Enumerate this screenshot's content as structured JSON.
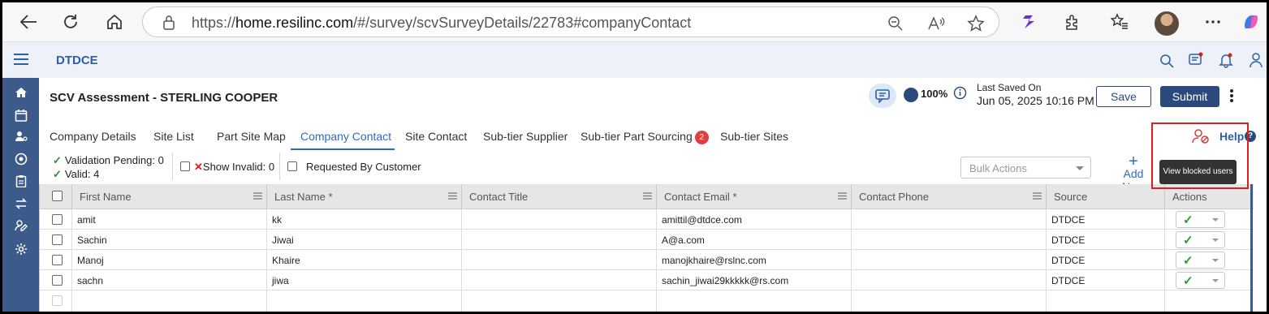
{
  "browser": {
    "url_prefix": "https://",
    "url_host": "home.resilinc.com",
    "url_path": "/#/survey/scvSurveyDetails/22783#companyContact"
  },
  "app": {
    "title": "DTDCE"
  },
  "page": {
    "title": "SCV Assessment - STERLING COOPER",
    "progress": "100%",
    "last_saved_label": "Last Saved On",
    "last_saved_time": "Jun 05, 2025 10:16 PM",
    "save_label": "Save",
    "submit_label": "Submit"
  },
  "tabs": [
    {
      "label": "Company Details"
    },
    {
      "label": "Site List"
    },
    {
      "label": "Part Site Map"
    },
    {
      "label": "Company Contact"
    },
    {
      "label": "Site Contact"
    },
    {
      "label": "Sub-tier Supplier"
    },
    {
      "label": "Sub-tier Part Sourcing",
      "badge": "2"
    },
    {
      "label": "Sub-tier Sites"
    }
  ],
  "help": {
    "label": "Help",
    "q": "?"
  },
  "tooltip": {
    "text": "View blocked users"
  },
  "toolbar": {
    "validation_pending": "Validation Pending: 0",
    "valid": "Valid: 4",
    "show_invalid": "Show Invalid: 0",
    "requested_by_customer": "Requested By Customer",
    "bulk_actions_placeholder": "Bulk Actions",
    "add_new": "Add New"
  },
  "grid": {
    "columns": [
      "First Name",
      "Last Name *",
      "Contact Title",
      "Contact Email *",
      "Contact Phone",
      "Source",
      "Actions"
    ],
    "rows": [
      {
        "first": "amit",
        "last": "kk",
        "title": "",
        "email": "amittil@dtdce.com",
        "phone": "",
        "source": "DTDCE"
      },
      {
        "first": "Sachin",
        "last": "Jiwai",
        "title": "",
        "email": "A@a.com",
        "phone": "",
        "source": "DTDCE"
      },
      {
        "first": "Manoj",
        "last": "Khaire",
        "title": "",
        "email": "manojkhaire@rslnc.com",
        "phone": "",
        "source": "DTDCE"
      },
      {
        "first": "sachn",
        "last": "jiwa",
        "title": "",
        "email": "sachin_jiwai29kkkkk@rs.com",
        "phone": "",
        "source": "DTDCE"
      }
    ]
  },
  "colors": {
    "primary": "#2a4a7d",
    "accent_blue": "#2d6bc4",
    "rail": "#3c5a8a",
    "highlight_red": "#d82020",
    "valid_green": "#2e8b2e"
  }
}
